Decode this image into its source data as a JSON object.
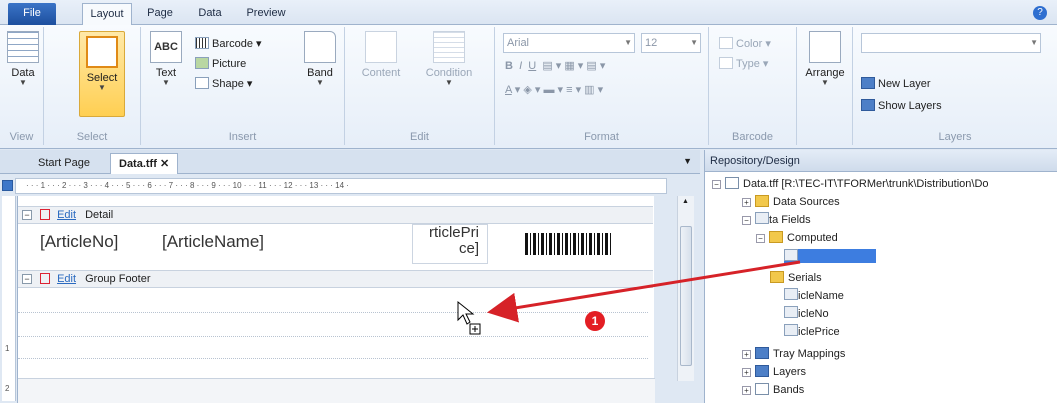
{
  "tabs": {
    "file": "File",
    "layout": "Layout",
    "page": "Page",
    "data": "Data",
    "preview": "Preview"
  },
  "ribbon": {
    "view": {
      "data_btn": "Data",
      "label": "View"
    },
    "select": {
      "select_btn": "Select",
      "label": "Select"
    },
    "insert": {
      "text_btn": "Text",
      "barcode": "Barcode",
      "picture": "Picture",
      "shape": "Shape",
      "band": "Band",
      "label": "Insert"
    },
    "edit": {
      "content": "Content",
      "condition": "Condition",
      "label": "Edit"
    },
    "format": {
      "font": "Arial",
      "size": "12",
      "label": "Format"
    },
    "barcode": {
      "color": "Color",
      "type": "Type",
      "label": "Barcode"
    },
    "arrange": {
      "arrange": "Arrange"
    },
    "layers": {
      "new_layer": "New Layer",
      "show_layers": "Show Layers",
      "label": "Layers"
    }
  },
  "doc": {
    "tabs": [
      "Start Page",
      "Data.tff"
    ],
    "ruler": "· · · 1 · · · 2 · · · 3 · · · 4 · · · 5 · · · 6 · · · 7 · · · 8 · · · 9 · · · 10 · · · 11 · · · 12 · · · 13 · · · 14 ·",
    "vruler": [
      "1",
      "2"
    ],
    "detail_band": {
      "edit": "Edit",
      "name": "Detail"
    },
    "footer_band": {
      "edit": "Edit",
      "name": "Group Footer"
    },
    "fields": {
      "article_no": "[ArticleNo]",
      "article_name": "[ArticleName]",
      "price_1": "rticlePri",
      "price_2": "ce]"
    }
  },
  "pane": {
    "title": "Repository/Design",
    "root": "Data.tff [R:\\TEC-IT\\TFORMer\\trunk\\Distribution\\Do",
    "data_sources": "Data Sources",
    "data_fields": "Data Fields",
    "computed": "Computed",
    "serials": "Serials",
    "f1": "ArticleName",
    "f2": "ArticleNo",
    "f3": "ArticlePrice",
    "tray": "Tray Mappings",
    "layers": "Layers",
    "bands": "Bands"
  },
  "annotation": {
    "badge": "1"
  },
  "colors": {
    "accent": "#3d7de0",
    "arrow": "#d62228",
    "badge": "#e31e24"
  }
}
